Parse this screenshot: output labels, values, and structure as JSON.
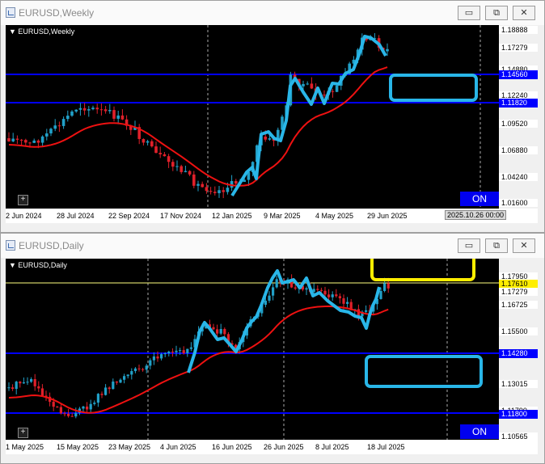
{
  "weekly": {
    "title": "EURUSD,Weekly",
    "symbol_label": "EURUSD,Weekly",
    "price_labels": [
      "1.18888",
      "1.17279",
      "1.14880",
      "1.12240",
      "1.09520",
      "1.06880",
      "1.04240",
      "1.01600"
    ],
    "tag_labels": [
      "1.14560",
      "1.11820"
    ],
    "x_labels": [
      "2 Jun 2024",
      "28 Jul 2024",
      "22 Sep 2024",
      "17 Nov 2024",
      "12 Jan 2025",
      "9 Mar 2025",
      "4 May 2025",
      "29 Jun 2025"
    ],
    "cursor_date": "2025.10.26 00:00",
    "on_label": "ON",
    "plus_label": "+"
  },
  "daily": {
    "title": "EURUSD,Daily",
    "symbol_label": "EURUSD,Daily",
    "price_labels": [
      "1.17950",
      "1.16725",
      "1.15500",
      "1.14275",
      "1.13015",
      "1.11790",
      "1.10565"
    ],
    "current_prices": [
      "1.17610",
      "1.17279"
    ],
    "tag_labels": [
      "1.14280",
      "1.11800"
    ],
    "x_labels": [
      "1 May 2025",
      "15 May 2025",
      "23 May 2025",
      "4 Jun 2025",
      "16 Jun 2025",
      "26 Jun 2025",
      "8 Jul 2025",
      "18 Jul 2025"
    ],
    "on_label": "ON",
    "plus_label": "+"
  },
  "window_buttons": {
    "minimize": "▭",
    "restore": "⧉",
    "close": "✕"
  },
  "colors": {
    "bull": "#21a0c8",
    "bear": "#e0202a",
    "ma": "#ee1111",
    "level": "#0000ff",
    "highlight_blue": "#29b6e8",
    "highlight_yellow": "#ffee00",
    "current_line": "#ffff80"
  }
}
